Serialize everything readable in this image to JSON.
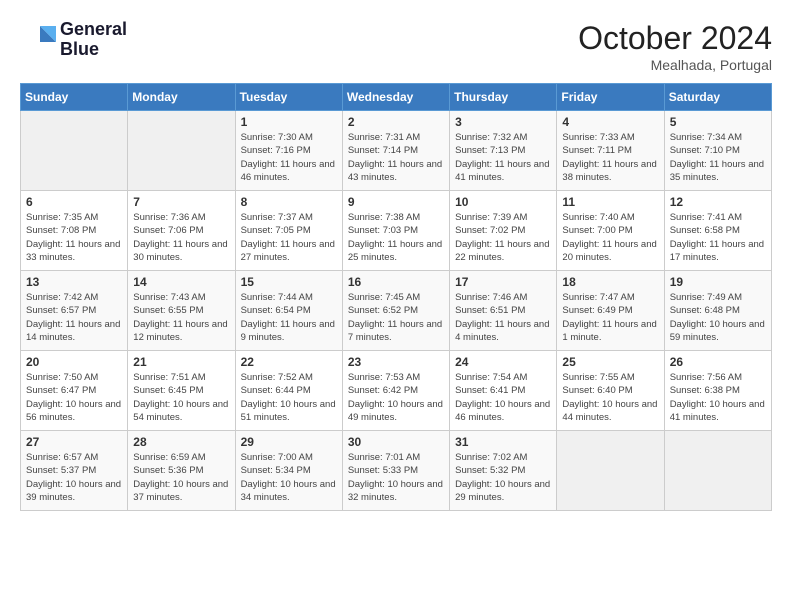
{
  "header": {
    "logo_line1": "General",
    "logo_line2": "Blue",
    "month": "October 2024",
    "location": "Mealhada, Portugal"
  },
  "weekdays": [
    "Sunday",
    "Monday",
    "Tuesday",
    "Wednesday",
    "Thursday",
    "Friday",
    "Saturday"
  ],
  "weeks": [
    [
      {
        "day": "",
        "info": ""
      },
      {
        "day": "",
        "info": ""
      },
      {
        "day": "1",
        "info": "Sunrise: 7:30 AM\nSunset: 7:16 PM\nDaylight: 11 hours and 46 minutes."
      },
      {
        "day": "2",
        "info": "Sunrise: 7:31 AM\nSunset: 7:14 PM\nDaylight: 11 hours and 43 minutes."
      },
      {
        "day": "3",
        "info": "Sunrise: 7:32 AM\nSunset: 7:13 PM\nDaylight: 11 hours and 41 minutes."
      },
      {
        "day": "4",
        "info": "Sunrise: 7:33 AM\nSunset: 7:11 PM\nDaylight: 11 hours and 38 minutes."
      },
      {
        "day": "5",
        "info": "Sunrise: 7:34 AM\nSunset: 7:10 PM\nDaylight: 11 hours and 35 minutes."
      }
    ],
    [
      {
        "day": "6",
        "info": "Sunrise: 7:35 AM\nSunset: 7:08 PM\nDaylight: 11 hours and 33 minutes."
      },
      {
        "day": "7",
        "info": "Sunrise: 7:36 AM\nSunset: 7:06 PM\nDaylight: 11 hours and 30 minutes."
      },
      {
        "day": "8",
        "info": "Sunrise: 7:37 AM\nSunset: 7:05 PM\nDaylight: 11 hours and 27 minutes."
      },
      {
        "day": "9",
        "info": "Sunrise: 7:38 AM\nSunset: 7:03 PM\nDaylight: 11 hours and 25 minutes."
      },
      {
        "day": "10",
        "info": "Sunrise: 7:39 AM\nSunset: 7:02 PM\nDaylight: 11 hours and 22 minutes."
      },
      {
        "day": "11",
        "info": "Sunrise: 7:40 AM\nSunset: 7:00 PM\nDaylight: 11 hours and 20 minutes."
      },
      {
        "day": "12",
        "info": "Sunrise: 7:41 AM\nSunset: 6:58 PM\nDaylight: 11 hours and 17 minutes."
      }
    ],
    [
      {
        "day": "13",
        "info": "Sunrise: 7:42 AM\nSunset: 6:57 PM\nDaylight: 11 hours and 14 minutes."
      },
      {
        "day": "14",
        "info": "Sunrise: 7:43 AM\nSunset: 6:55 PM\nDaylight: 11 hours and 12 minutes."
      },
      {
        "day": "15",
        "info": "Sunrise: 7:44 AM\nSunset: 6:54 PM\nDaylight: 11 hours and 9 minutes."
      },
      {
        "day": "16",
        "info": "Sunrise: 7:45 AM\nSunset: 6:52 PM\nDaylight: 11 hours and 7 minutes."
      },
      {
        "day": "17",
        "info": "Sunrise: 7:46 AM\nSunset: 6:51 PM\nDaylight: 11 hours and 4 minutes."
      },
      {
        "day": "18",
        "info": "Sunrise: 7:47 AM\nSunset: 6:49 PM\nDaylight: 11 hours and 1 minute."
      },
      {
        "day": "19",
        "info": "Sunrise: 7:49 AM\nSunset: 6:48 PM\nDaylight: 10 hours and 59 minutes."
      }
    ],
    [
      {
        "day": "20",
        "info": "Sunrise: 7:50 AM\nSunset: 6:47 PM\nDaylight: 10 hours and 56 minutes."
      },
      {
        "day": "21",
        "info": "Sunrise: 7:51 AM\nSunset: 6:45 PM\nDaylight: 10 hours and 54 minutes."
      },
      {
        "day": "22",
        "info": "Sunrise: 7:52 AM\nSunset: 6:44 PM\nDaylight: 10 hours and 51 minutes."
      },
      {
        "day": "23",
        "info": "Sunrise: 7:53 AM\nSunset: 6:42 PM\nDaylight: 10 hours and 49 minutes."
      },
      {
        "day": "24",
        "info": "Sunrise: 7:54 AM\nSunset: 6:41 PM\nDaylight: 10 hours and 46 minutes."
      },
      {
        "day": "25",
        "info": "Sunrise: 7:55 AM\nSunset: 6:40 PM\nDaylight: 10 hours and 44 minutes."
      },
      {
        "day": "26",
        "info": "Sunrise: 7:56 AM\nSunset: 6:38 PM\nDaylight: 10 hours and 41 minutes."
      }
    ],
    [
      {
        "day": "27",
        "info": "Sunrise: 6:57 AM\nSunset: 5:37 PM\nDaylight: 10 hours and 39 minutes."
      },
      {
        "day": "28",
        "info": "Sunrise: 6:59 AM\nSunset: 5:36 PM\nDaylight: 10 hours and 37 minutes."
      },
      {
        "day": "29",
        "info": "Sunrise: 7:00 AM\nSunset: 5:34 PM\nDaylight: 10 hours and 34 minutes."
      },
      {
        "day": "30",
        "info": "Sunrise: 7:01 AM\nSunset: 5:33 PM\nDaylight: 10 hours and 32 minutes."
      },
      {
        "day": "31",
        "info": "Sunrise: 7:02 AM\nSunset: 5:32 PM\nDaylight: 10 hours and 29 minutes."
      },
      {
        "day": "",
        "info": ""
      },
      {
        "day": "",
        "info": ""
      }
    ]
  ]
}
